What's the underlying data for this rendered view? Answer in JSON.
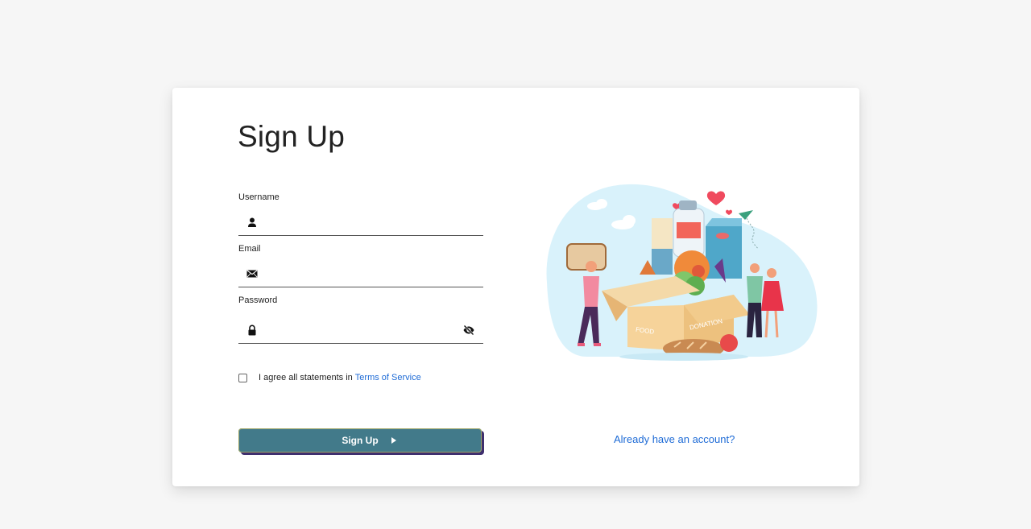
{
  "form": {
    "title": "Sign Up",
    "username_label": "Username",
    "email_label": "Email",
    "password_label": "Password",
    "username_value": "",
    "email_value": "",
    "password_value": "",
    "agree_text": "I agree all statements in",
    "terms_link": "Terms of Service",
    "agree_checked": false,
    "submit_label": "Sign Up",
    "login_link": "Already have an account?"
  },
  "illustration": {
    "box_text_1": "FOOD",
    "box_text_2": "DONATION"
  },
  "colors": {
    "page_bg": "#f6f6f6",
    "button": "#427a8a",
    "button_shadow": "#3f2f6e",
    "link": "#1e6bd6"
  }
}
